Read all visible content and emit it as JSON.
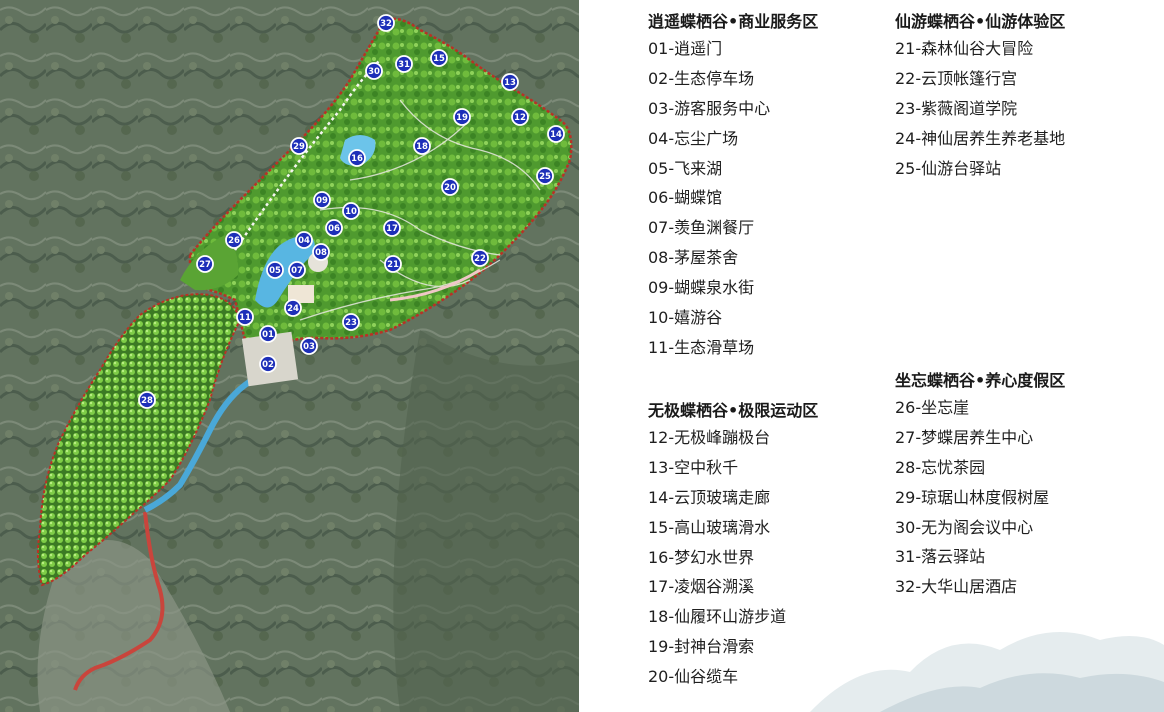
{
  "zones": [
    {
      "title": "逍遥蝶栖谷•商业服务区",
      "items": [
        "01-逍遥门",
        "02-生态停车场",
        "03-游客服务中心",
        "04-忘尘广场",
        "05-飞来湖",
        "06-蝴蝶馆",
        "07-羡鱼渊餐厅",
        "08-茅屋茶舍",
        "09-蝴蝶泉水街",
        "10-嬉游谷",
        "11-生态滑草场"
      ]
    },
    {
      "title": "无极蝶栖谷•极限运动区",
      "items": [
        "12-无极峰蹦极台",
        "13-空中秋千",
        "14-云顶玻璃走廊",
        "15-高山玻璃滑水",
        "16-梦幻水世界",
        "17-凌烟谷溯溪",
        "18-仙履环山游步道",
        "19-封神台滑索",
        "20-仙谷缆车"
      ]
    },
    {
      "title": "仙游蝶栖谷•仙游体验区",
      "items": [
        "21-森林仙谷大冒险",
        "22-云顶帐篷行宫",
        "23-紫薇阁道学院",
        "24-神仙居养生养老基地",
        "25-仙游台驿站"
      ]
    },
    {
      "title": "坐忘蝶栖谷•养心度假区",
      "items": [
        "26-坐忘崖",
        "27-梦蝶居养生中心",
        "28-忘忧茶园",
        "29-琼琚山林度假树屋",
        "30-无为阁会议中心",
        "31-落云驿站",
        "32-大华山居酒店"
      ]
    }
  ],
  "map_markers": [
    "01",
    "02",
    "03",
    "04",
    "05",
    "06",
    "07",
    "08",
    "09",
    "10",
    "11",
    "12",
    "13",
    "14",
    "15",
    "16",
    "17",
    "18",
    "19",
    "20",
    "21",
    "22",
    "23",
    "24",
    "25",
    "26",
    "27",
    "28",
    "29",
    "30",
    "31",
    "32"
  ],
  "colors": {
    "marker_fill": "#1d2fb8",
    "marker_stroke": "#ffffff",
    "boundary": "#b83226",
    "park_green": "#4e9a2c",
    "water": "#4aa8d8",
    "mountain": "#5f7260",
    "road": "#c9453c"
  }
}
